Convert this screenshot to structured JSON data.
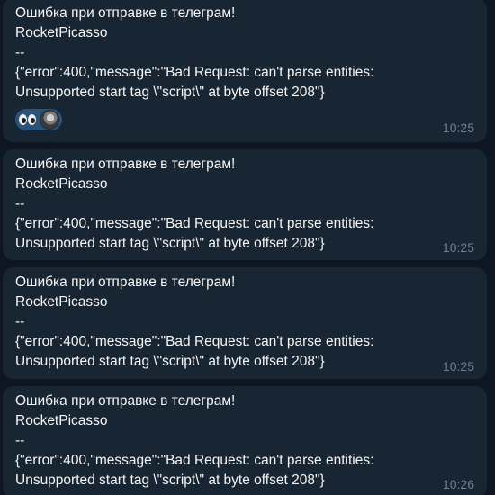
{
  "messages": [
    {
      "lines": [
        "Ошибка при отправке в телеграм!",
        "RocketPicasso",
        "--",
        "{\"error\":400,\"message\":\"Bad Request: can't parse entities:",
        "Unsupported start tag \\\"script\\\" at byte offset 208\"}"
      ],
      "time": "10:25",
      "reaction": "eyes"
    },
    {
      "lines": [
        "Ошибка при отправке в телеграм!",
        "RocketPicasso",
        "--",
        "{\"error\":400,\"message\":\"Bad Request: can't parse entities:",
        "Unsupported start tag \\\"script\\\" at byte offset 208\"}"
      ],
      "time": "10:25"
    },
    {
      "lines": [
        "Ошибка при отправке в телеграм!",
        "RocketPicasso",
        "--",
        "{\"error\":400,\"message\":\"Bad Request: can't parse entities:",
        "Unsupported start tag \\\"script\\\" at byte offset 208\"}"
      ],
      "time": "10:25"
    },
    {
      "lines": [
        "Ошибка при отправке в телеграм!",
        "RocketPicasso",
        "--",
        "{\"error\":400,\"message\":\"Bad Request: can't parse entities:",
        "Unsupported start tag \\\"script\\\" at byte offset 208\"}"
      ],
      "time": "10:26"
    }
  ],
  "colors": {
    "background": "#0e1621",
    "bubble": "#182533",
    "text": "#f5f5f5",
    "time": "#6d7f8f",
    "reaction_chip": "#2b5278"
  }
}
